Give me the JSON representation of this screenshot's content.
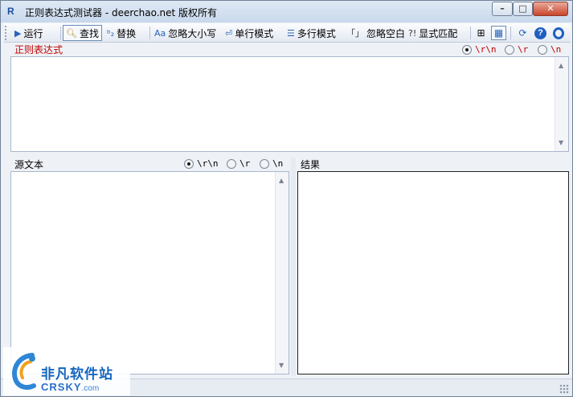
{
  "window": {
    "app_icon": "R",
    "title": "正则表达式测试器 - deerchao.net 版权所有",
    "controls": {
      "minimize": "minimize-icon",
      "maximize": "maximize-icon",
      "close": "close-icon"
    }
  },
  "toolbar": {
    "run": "运行",
    "find": "查找",
    "replace": "替换",
    "ignore_case": "忽略大小写",
    "single_line": "单行模式",
    "multi_line": "多行模式",
    "ignore_whitespace": "忽略空白",
    "ignore_whitespace_icon": "「」",
    "explicit_capture": "显式匹配",
    "explicit_capture_icon": "?!",
    "icons": [
      "tree-view-icon",
      "grid-view-icon",
      "refresh-icon",
      "help-icon",
      "info-icon"
    ]
  },
  "regex": {
    "label": "正则表达式",
    "newline_options": [
      "\\r\\n",
      "\\r",
      "\\n"
    ],
    "selected_newline": "\\r\\n",
    "value": ""
  },
  "source": {
    "label": "源文本",
    "newline_options": [
      "\\r\\n",
      "\\r",
      "\\n"
    ],
    "selected_newline": "\\r\\n",
    "value": ""
  },
  "results": {
    "label": "结果"
  },
  "watermark": {
    "cn": "非凡软件站",
    "en_main": "CRSKY",
    "en_suffix": ".com"
  },
  "colors": {
    "accent_red": "#c00000",
    "watermark_blue": "#1565c0"
  }
}
